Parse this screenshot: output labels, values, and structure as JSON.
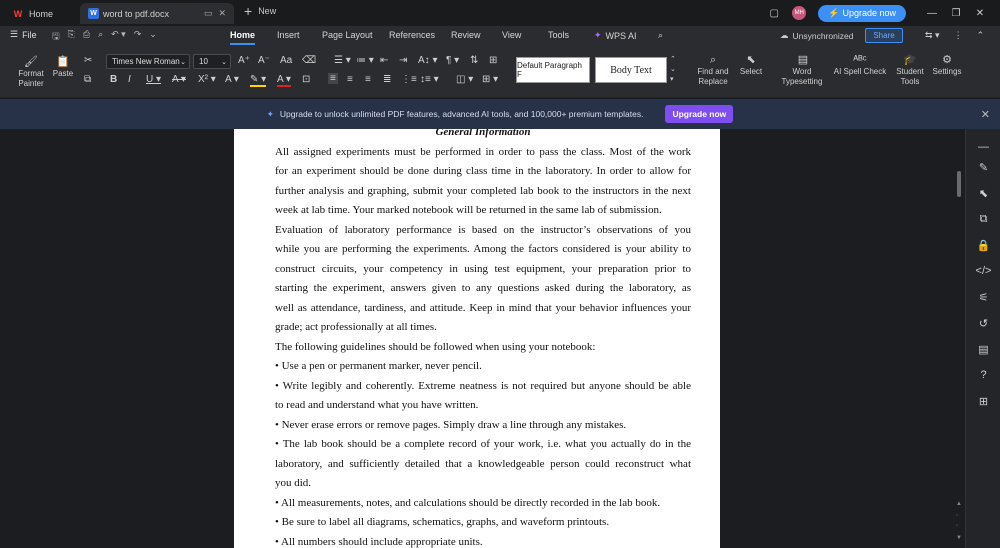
{
  "titlebar": {
    "tabs": [
      {
        "label": "Home",
        "icon": "wps-logo-icon"
      },
      {
        "label": "word to pdf.docx",
        "icon": "word-doc-icon"
      }
    ],
    "new_tab_label": "New",
    "avatar_initials": "MH",
    "upgrade_label": "Upgrade now"
  },
  "menubar": {
    "file_label": "File",
    "tabs": [
      "Home",
      "Insert",
      "Page Layout",
      "References",
      "Review",
      "View",
      "Tools",
      "WPS AI"
    ],
    "active_tab": "Home",
    "sync_status": "Unsynchronized",
    "share_label": "Share"
  },
  "ribbon": {
    "format_painter": "Format Painter",
    "paste": "Paste",
    "font_name": "Times New Roman",
    "font_size": "10",
    "styles": [
      {
        "label": "Default Paragraph F"
      },
      {
        "label": "Body Text"
      }
    ],
    "find_replace": "Find and Replace",
    "select": "Select",
    "word_typesetting": "Word Typesetting",
    "ai_spell_check": "AI Spell Check",
    "student_tools": "Student Tools",
    "settings": "Settings"
  },
  "banner": {
    "text": "Upgrade to unlock unlimited PDF features, advanced AI tools, and 100,000+ premium templates.",
    "button": "Upgrade now"
  },
  "document": {
    "heading": "General Information",
    "p1": [
      "All assigned experiments must be performed in order to pass the class. Most of the work",
      "for an experiment should be done during class time in the laboratory. In order to allow for",
      "further analysis and graphing, submit your completed lab book to the instructors in the next",
      "week at lab time. Your marked notebook will be returned in the same lab of submission."
    ],
    "p2": [
      "Evaluation of laboratory performance is based on the instructor’s observations of you",
      "while you are performing the experiments. Among the factors considered is your ability to",
      "construct circuits, your competency in using test equipment, your preparation prior to",
      "starting the experiment, answers given to any questions asked during the laboratory, as",
      "well as attendance, tardiness, and attitude. Keep in mind that your behavior influences your",
      "grade; act professionally at all times."
    ],
    "intro": "The following guidelines should be followed when using your notebook:",
    "bullets": [
      [
        "• Use a pen or permanent marker, never pencil."
      ],
      [
        "• Write legibly and coherently. Extreme neatness is not required but anyone should be able",
        "to read and understand what you have written."
      ],
      [
        "• Never erase errors or remove pages. Simply draw a line through any mistakes."
      ],
      [
        "• The lab book should be a complete record of your work, i.e. what you actually do in the",
        "laboratory, and sufficiently detailed that a knowledgeable person could reconstruct what",
        "you did."
      ],
      [
        "• All measurements, notes, and calculations should be directly recorded in the lab book."
      ],
      [
        "• Be sure to label all diagrams, schematics, graphs, and waveform printouts."
      ],
      [
        "• All numbers should include appropriate units."
      ]
    ]
  }
}
